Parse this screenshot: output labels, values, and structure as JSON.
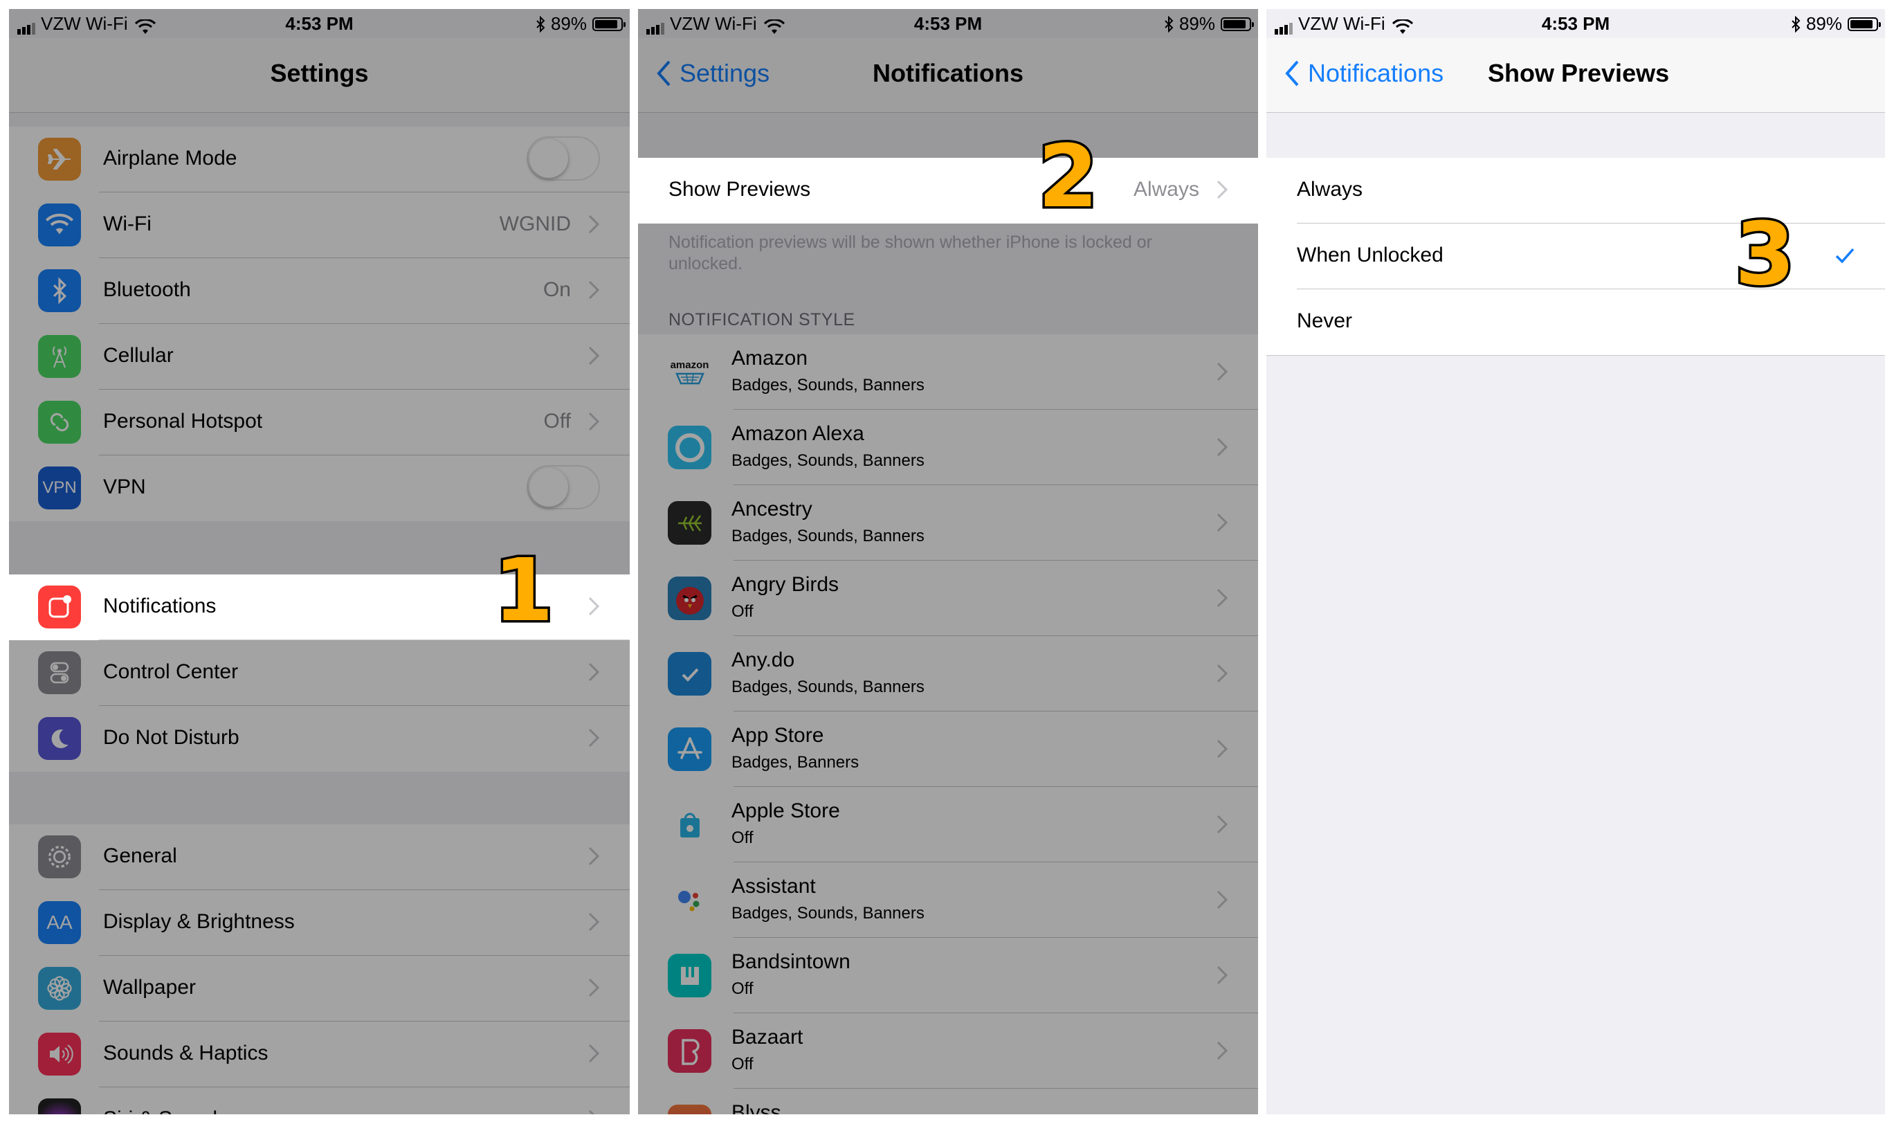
{
  "status": {
    "carrier": "VZW Wi-Fi",
    "time": "4:53 PM",
    "battery": "89%",
    "battery_level": 0.89
  },
  "panel1": {
    "title": "Settings",
    "group1": [
      {
        "label": "Airplane Mode",
        "icon": "airplane-icon",
        "color": "#f19a37",
        "control": "toggle"
      },
      {
        "label": "Wi-Fi",
        "value": "WGNID",
        "icon": "wifi-icon",
        "color": "#1a82fb"
      },
      {
        "label": "Bluetooth",
        "value": "On",
        "icon": "bluetooth-icon",
        "color": "#1a82fb"
      },
      {
        "label": "Cellular",
        "icon": "cellular-icon",
        "color": "#4cd964"
      },
      {
        "label": "Personal Hotspot",
        "value": "Off",
        "icon": "hotspot-icon",
        "color": "#4cd964"
      },
      {
        "label": "VPN",
        "icon": "vpn-icon",
        "icon_text": "VPN",
        "color": "#1a5fd0",
        "control": "toggle"
      }
    ],
    "group2": [
      {
        "label": "Notifications",
        "icon": "notifications-icon",
        "color": "#fc3d39"
      },
      {
        "label": "Control Center",
        "icon": "control-center-icon",
        "color": "#8e8e93"
      },
      {
        "label": "Do Not Disturb",
        "icon": "moon-icon",
        "color": "#5856d6"
      }
    ],
    "group3": [
      {
        "label": "General",
        "icon": "gear-icon",
        "color": "#8e8e93"
      },
      {
        "label": "Display & Brightness",
        "icon": "display-icon",
        "icon_text": "AA",
        "color": "#1a82fb"
      },
      {
        "label": "Wallpaper",
        "icon": "wallpaper-icon",
        "color": "#35aadc"
      },
      {
        "label": "Sounds & Haptics",
        "icon": "sound-icon",
        "color": "#fc3158"
      },
      {
        "label": "Siri & Search",
        "icon": "siri-icon",
        "color": "#222222"
      }
    ],
    "step": "1"
  },
  "panel2": {
    "back": "Settings",
    "title": "Notifications",
    "show_previews": {
      "label": "Show Previews",
      "value": "Always"
    },
    "footer": "Notification previews will be shown whether iPhone is locked or unlocked.",
    "section_header": "NOTIFICATION STYLE",
    "apps": [
      {
        "name": "Amazon",
        "sub": "Badges, Sounds, Banners",
        "icon": "amazon-icon",
        "icon_text": "amazon",
        "color": "#ffffff"
      },
      {
        "name": "Amazon Alexa",
        "sub": "Badges, Sounds, Banners",
        "icon": "alexa-icon",
        "color": "#31c4f3"
      },
      {
        "name": "Ancestry",
        "sub": "Badges, Sounds, Banners",
        "icon": "ancestry-icon",
        "color": "#2b2b2b"
      },
      {
        "name": "Angry Birds",
        "sub": "Off",
        "icon": "angry-birds-icon",
        "color": "#d8262c"
      },
      {
        "name": "Any.do",
        "sub": "Badges, Sounds, Banners",
        "icon": "anydo-icon",
        "color": "#1e88d8"
      },
      {
        "name": "App Store",
        "sub": "Badges, Banners",
        "icon": "app-store-icon",
        "color": "#1a9bf5"
      },
      {
        "name": "Apple Store",
        "sub": "Off",
        "icon": "apple-store-icon",
        "color": "#ffffff"
      },
      {
        "name": "Assistant",
        "sub": "Badges, Sounds, Banners",
        "icon": "assistant-icon",
        "color": "#ffffff"
      },
      {
        "name": "Bandsintown",
        "sub": "Off",
        "icon": "bandsintown-icon",
        "color": "#00cec8"
      },
      {
        "name": "Bazaart",
        "sub": "Off",
        "icon": "bazaart-icon",
        "color": "#e8305e"
      },
      {
        "name": "Blyss",
        "sub": "",
        "icon": "blyss-icon",
        "color": "#f05a3a"
      }
    ],
    "step": "2"
  },
  "panel3": {
    "back": "Notifications",
    "title": "Show Previews",
    "options": [
      {
        "label": "Always"
      },
      {
        "label": "When Unlocked",
        "selected": true
      },
      {
        "label": "Never"
      }
    ],
    "step": "3"
  },
  "colors": {
    "accent": "#157efb",
    "step_fill": "#ffad00"
  }
}
